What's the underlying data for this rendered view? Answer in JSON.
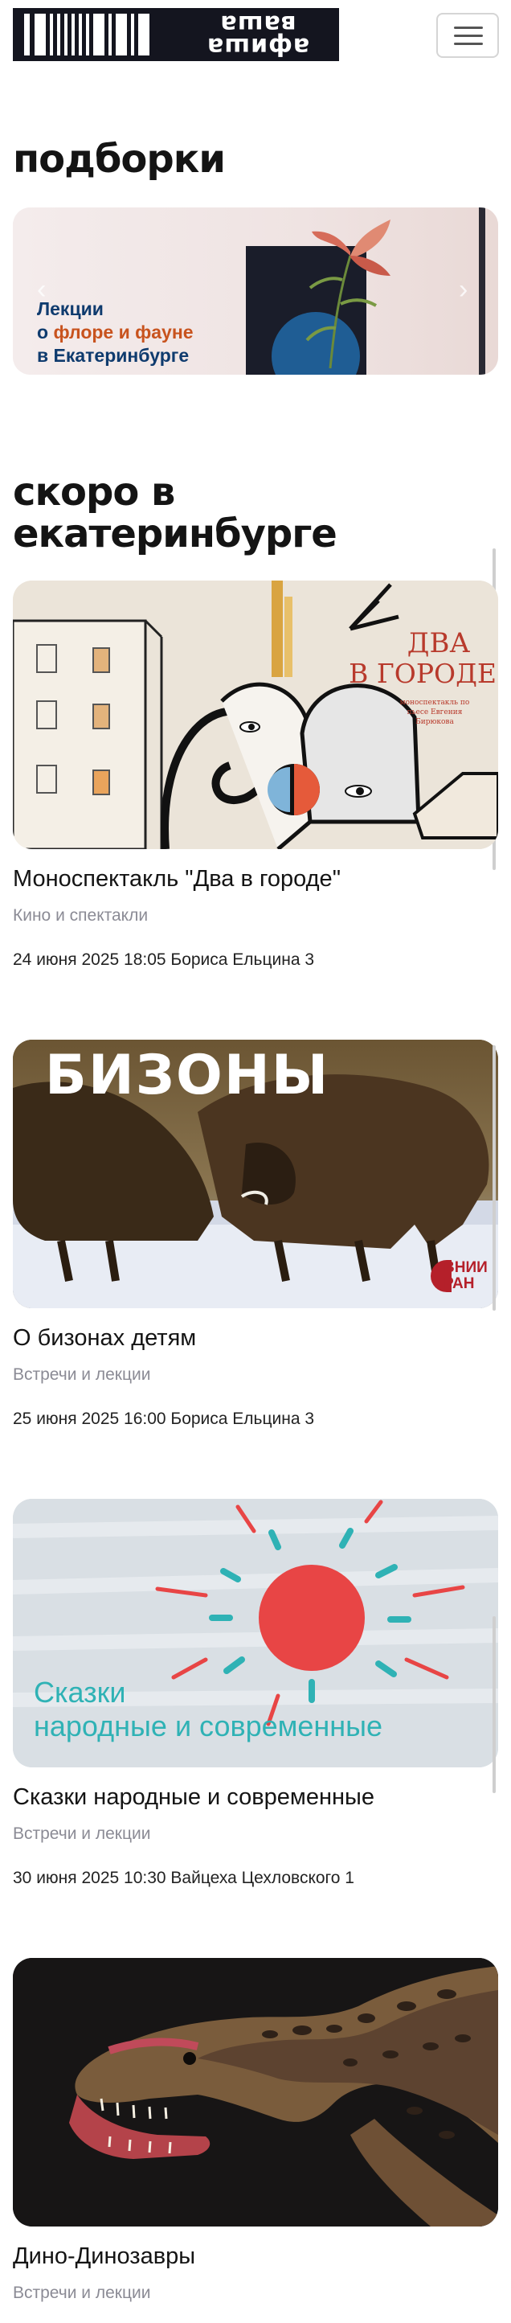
{
  "header": {
    "logo_line1": "ваша",
    "logo_line2": "афиша",
    "menu_icon": "hamburger-menu-icon"
  },
  "collections": {
    "title": "подборки",
    "banner": {
      "line1": "Лекции",
      "line2_prefix": "о ",
      "line2_highlight": "флоре и фауне",
      "line3": "в Екатеринбурге"
    }
  },
  "upcoming": {
    "title_line1": "скоро в",
    "title_line2": "екатеринбурге",
    "events": [
      {
        "title": "Моноспектакль \"Два в городе\"",
        "category": "Кино и спектакли",
        "meta": "24 июня 2025 18:05 Бориса Ельцина 3",
        "poster_line1": "ДВА",
        "poster_line2": "В ГОРОДЕ",
        "poster_sub": "моноспектакль по пьесе Евгения Бирюкова"
      },
      {
        "title": "О бизонах детям",
        "category": "Встречи и лекции",
        "meta": "25 июня 2025 16:00 Бориса Ельцина 3",
        "poster_title": "БИЗОНЫ",
        "poster_badge_1": "ВНИИ",
        "poster_badge_2": "РАН"
      },
      {
        "title": "Сказки народные и современные",
        "category": "Встречи и лекции",
        "meta": "30 июня 2025 10:30 Вайцеха Цехловского 1",
        "poster_line1": "Сказки",
        "poster_line2": "народные и современные"
      },
      {
        "title": "Дино-Динозавры",
        "category": "Встречи и лекции"
      }
    ]
  },
  "colors": {
    "accent_blue": "#0f3b6e",
    "accent_orange": "#c8531e",
    "muted": "#8b8b95",
    "poster_teal": "#2fb2b5",
    "poster_red": "#e84545"
  }
}
